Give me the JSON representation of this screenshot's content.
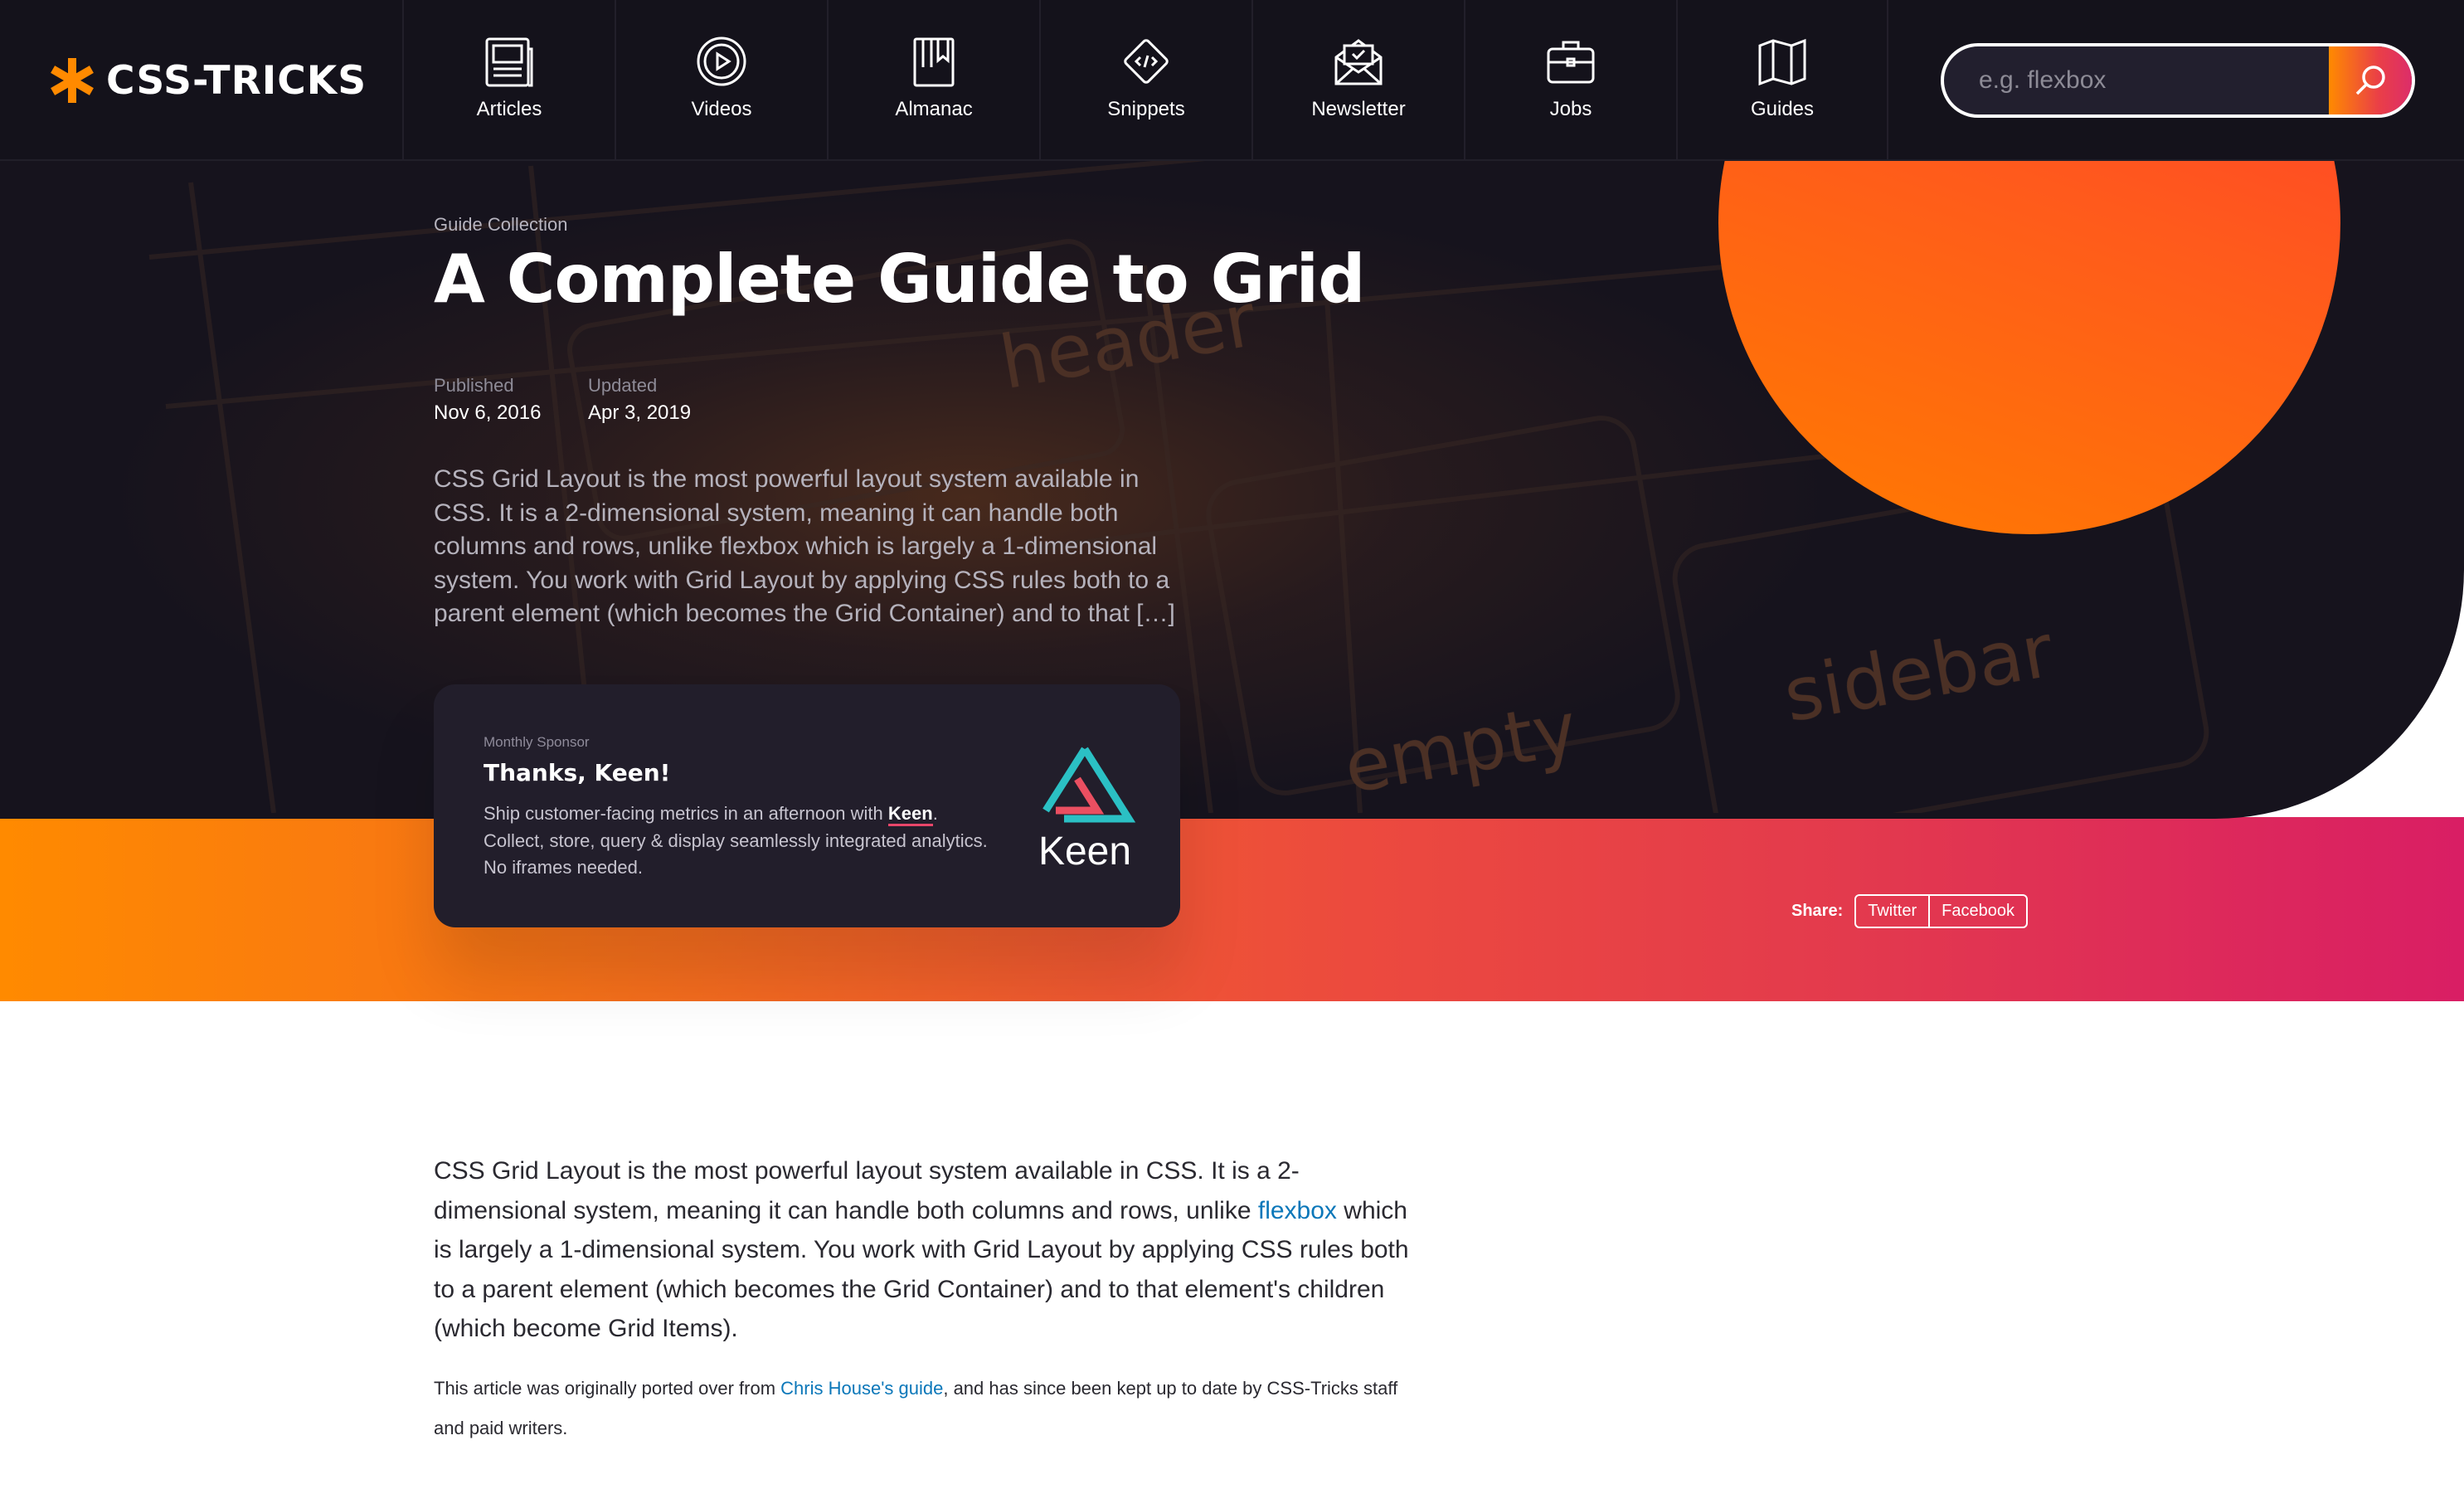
{
  "brand": {
    "logo_text": "CSS-TRICKS"
  },
  "nav": {
    "items": [
      {
        "label": "Articles",
        "icon": "articles-icon"
      },
      {
        "label": "Videos",
        "icon": "videos-icon"
      },
      {
        "label": "Almanac",
        "icon": "almanac-icon"
      },
      {
        "label": "Snippets",
        "icon": "snippets-icon"
      },
      {
        "label": "Newsletter",
        "icon": "newsletter-icon"
      },
      {
        "label": "Jobs",
        "icon": "jobs-icon"
      },
      {
        "label": "Guides",
        "icon": "guides-icon"
      }
    ]
  },
  "search": {
    "placeholder": "e.g. flexbox",
    "value": ""
  },
  "hero": {
    "eyebrow": "Guide Collection",
    "title": "A Complete Guide to Grid",
    "published_label": "Published",
    "published_date": "Nov 6, 2016",
    "updated_label": "Updated",
    "updated_date": "Apr 3, 2019",
    "excerpt": "CSS Grid Layout is the most powerful layout system available in CSS. It is a 2-dimensional system, meaning it can handle both columns and rows, unlike flexbox which is largely a 1-dimensional system. You work with Grid Layout by applying CSS rules both to a parent element (which becomes the Grid Container) and to that […]"
  },
  "sponsor": {
    "eyebrow": "Monthly Sponsor",
    "title": "Thanks, Keen!",
    "body_before": "Ship customer-facing metrics in an afternoon with ",
    "brand_link": "Keen",
    "body_after": ". Collect, store, query & display seamlessly integrated analytics. No iframes needed.",
    "logo_text": "Keen"
  },
  "share": {
    "label": "Share:",
    "buttons": [
      "Twitter",
      "Facebook"
    ]
  },
  "article": {
    "intro_before": "CSS Grid Layout is the most powerful layout system available in CSS. It is a 2-dimensional system, meaning it can handle both columns and rows, unlike ",
    "intro_link": "flexbox",
    "intro_after": " which is largely a 1-dimensional system. You work with Grid Layout by applying CSS rules both to a parent element (which becomes the Grid Container) and to that element's children (which become Grid Items).",
    "note_before": "This article was originally ported over from ",
    "note_link": "Chris House's guide",
    "note_after": ", and has since been kept up to date by CSS-Tricks staff and paid writers."
  },
  "colors": {
    "nav_background": "#14121b",
    "brand_orange": "#ff8a00",
    "gradient_end": "#d91e64",
    "circle": "#ff5a1c",
    "link": "#0b77b9",
    "keen_teal": "#2bc0c4",
    "keen_red": "#ea4f61"
  }
}
